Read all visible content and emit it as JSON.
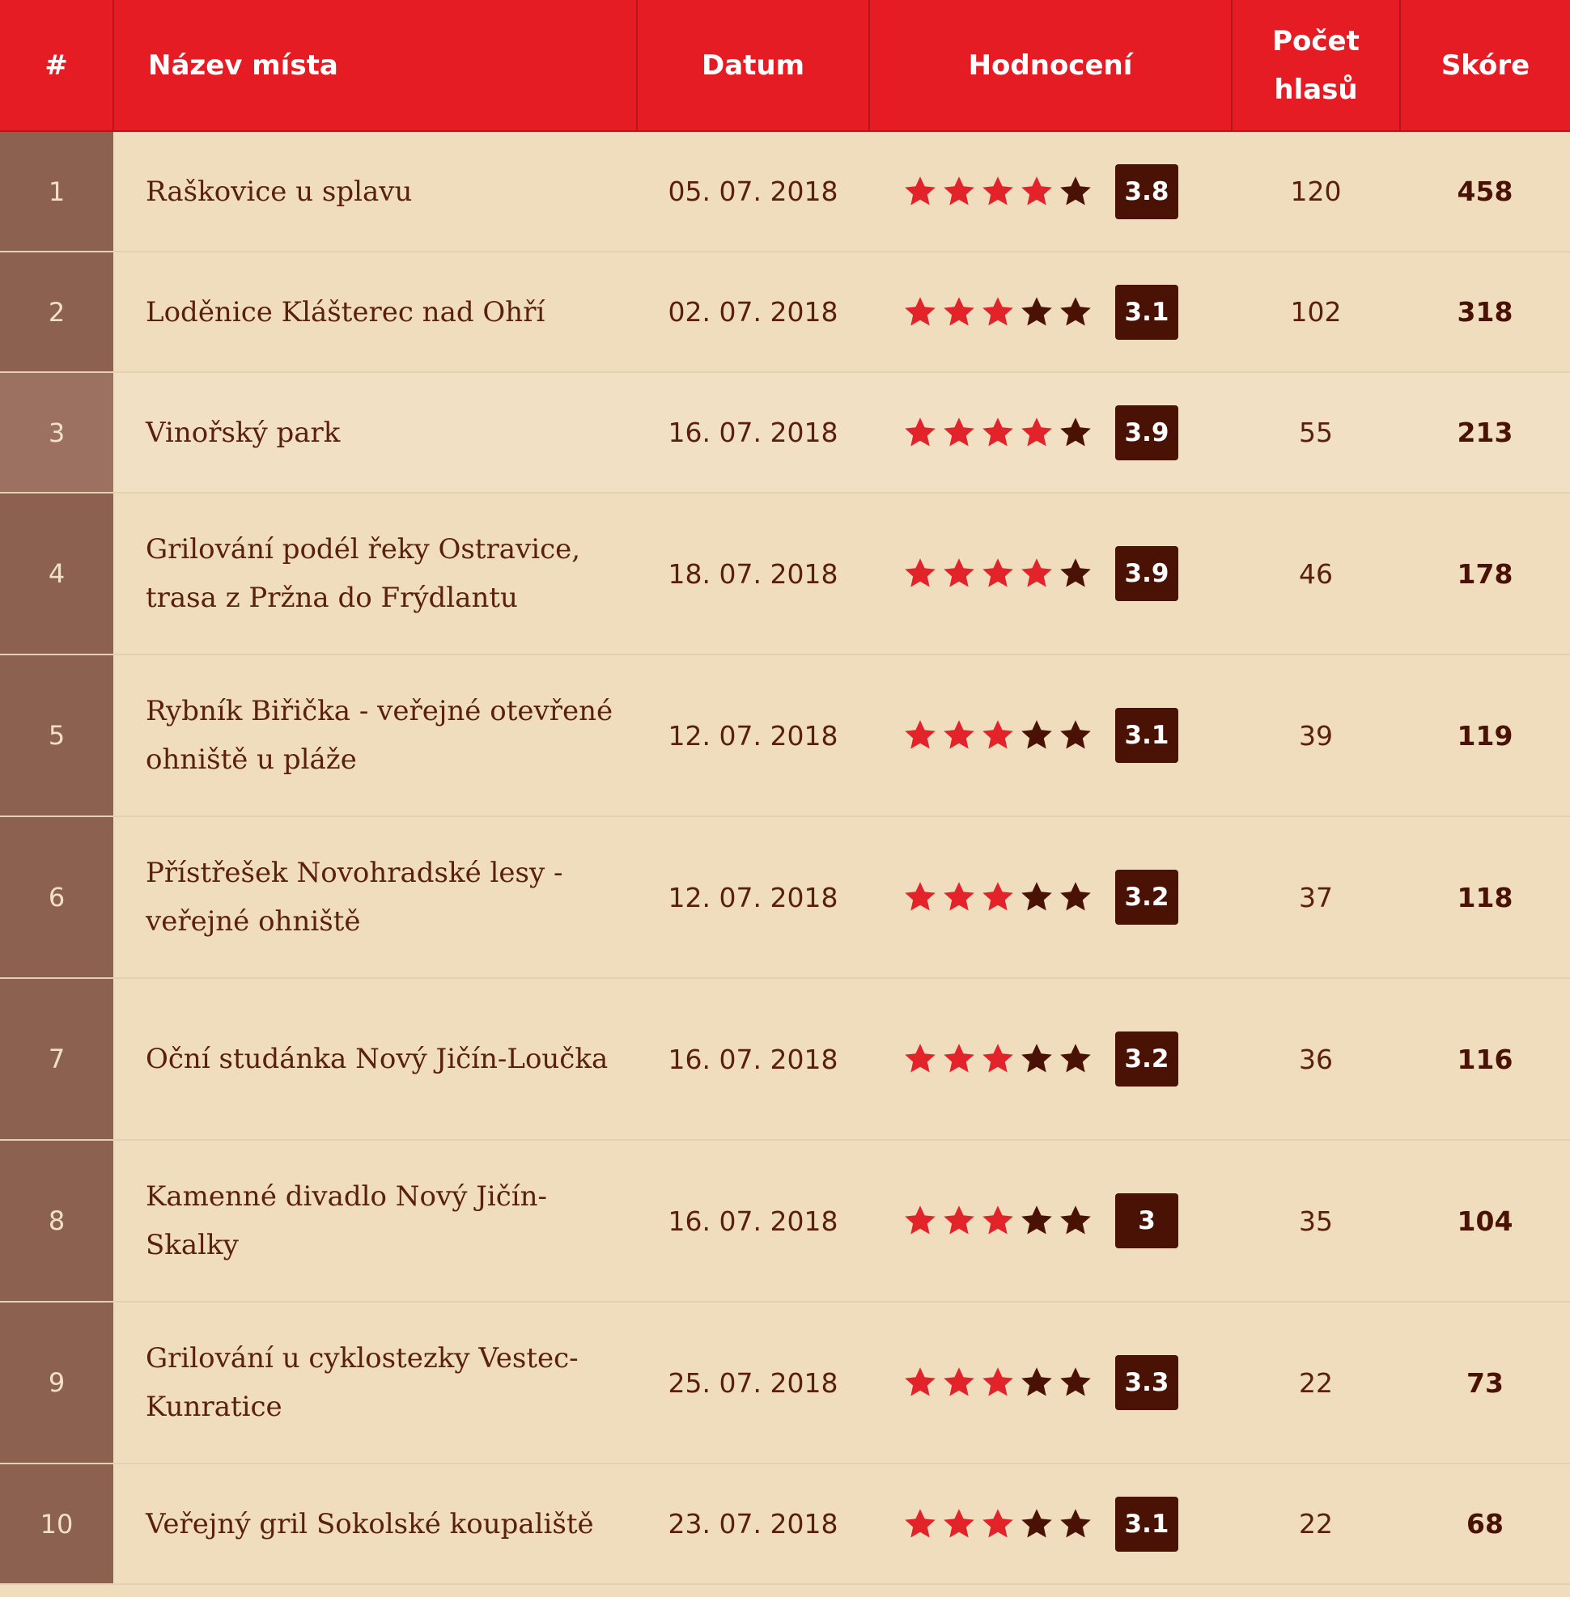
{
  "colors": {
    "header_bg": "#e51c24",
    "row_bg": "#efddbe",
    "rank_bg": "#8d6150",
    "star_active": "#e2232a",
    "star_inactive": "#4a1205",
    "badge_bg": "#4a1205"
  },
  "table": {
    "headers": {
      "rank": "#",
      "name": "Název místa",
      "date": "Datum",
      "rating": "Hodnocení",
      "votes_line1": "Počet",
      "votes_line2": "hlasů",
      "score": "Skóre"
    },
    "rows": [
      {
        "rank": "1",
        "name": "Raškovice u splavu",
        "date": "05. 07. 2018",
        "rating": "3.8",
        "stars_filled": 4,
        "votes": "120",
        "score": "458",
        "highlight": false
      },
      {
        "rank": "2",
        "name": "Loděnice Klášterec nad Ohří",
        "date": "02. 07. 2018",
        "rating": "3.1",
        "stars_filled": 3,
        "votes": "102",
        "score": "318",
        "highlight": false
      },
      {
        "rank": "3",
        "name": "Vinořský park",
        "date": "16. 07. 2018",
        "rating": "3.9",
        "stars_filled": 4,
        "votes": "55",
        "score": "213",
        "highlight": true
      },
      {
        "rank": "4",
        "name": "Grilování podél řeky Ostravice, trasa z Pržna do Frýdlantu",
        "date": "18. 07. 2018",
        "rating": "3.9",
        "stars_filled": 4,
        "votes": "46",
        "score": "178",
        "highlight": false
      },
      {
        "rank": "5",
        "name": "Rybník Biřička - veřejné otevřené ohniště u pláže",
        "date": "12. 07. 2018",
        "rating": "3.1",
        "stars_filled": 3,
        "votes": "39",
        "score": "119",
        "highlight": false
      },
      {
        "rank": "6",
        "name": "Přístřešek Novohradské lesy - veřejné ohniště",
        "date": "12. 07. 2018",
        "rating": "3.2",
        "stars_filled": 3,
        "votes": "37",
        "score": "118",
        "highlight": false
      },
      {
        "rank": "7",
        "name": "Oční studánka Nový Jičín-Loučka",
        "date": "16. 07. 2018",
        "rating": "3.2",
        "stars_filled": 3,
        "votes": "36",
        "score": "116",
        "highlight": false
      },
      {
        "rank": "8",
        "name": "Kamenné divadlo Nový Jičín-Skalky",
        "date": "16. 07. 2018",
        "rating": "3",
        "stars_filled": 3,
        "votes": "35",
        "score": "104",
        "highlight": false
      },
      {
        "rank": "9",
        "name": "Grilování u cyklostezky Vestec-Kunratice",
        "date": "25. 07. 2018",
        "rating": "3.3",
        "stars_filled": 3,
        "votes": "22",
        "score": "73",
        "highlight": false
      },
      {
        "rank": "10",
        "name": "Veřejný gril Sokolské koupaliště",
        "date": "23. 07. 2018",
        "rating": "3.1",
        "stars_filled": 3,
        "votes": "22",
        "score": "68",
        "highlight": false
      }
    ]
  }
}
